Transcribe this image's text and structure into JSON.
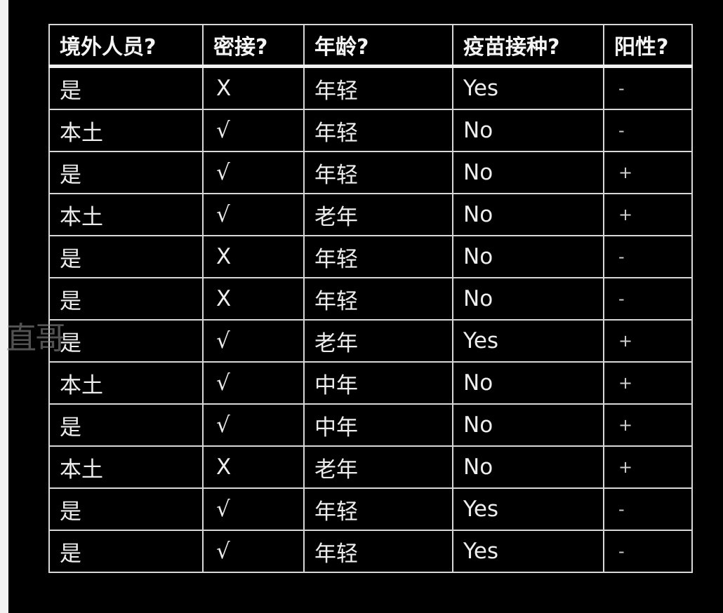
{
  "table": {
    "headers": [
      "境外人员?",
      "密接?",
      "年龄?",
      "疫苗接种?",
      "阳性?"
    ],
    "rows": [
      [
        "是",
        "X",
        "年轻",
        "Yes",
        "-"
      ],
      [
        "本土",
        "√",
        "年轻",
        "No",
        "-"
      ],
      [
        "是",
        "√",
        "年轻",
        "No",
        "+"
      ],
      [
        "本土",
        "√",
        "老年",
        "No",
        "+"
      ],
      [
        "是",
        "X",
        "年轻",
        "No",
        "-"
      ],
      [
        "是",
        "X",
        "年轻",
        "No",
        "-"
      ],
      [
        "是",
        "√",
        "老年",
        "Yes",
        "+"
      ],
      [
        "本土",
        "√",
        "中年",
        "No",
        "+"
      ],
      [
        "是",
        "√",
        "中年",
        "No",
        "+"
      ],
      [
        "本土",
        "X",
        "老年",
        "No",
        "+"
      ],
      [
        "是",
        "√",
        "年轻",
        "Yes",
        "-"
      ],
      [
        "是",
        "√",
        "年轻",
        "Yes",
        "-"
      ]
    ]
  },
  "watermark": "直哥"
}
